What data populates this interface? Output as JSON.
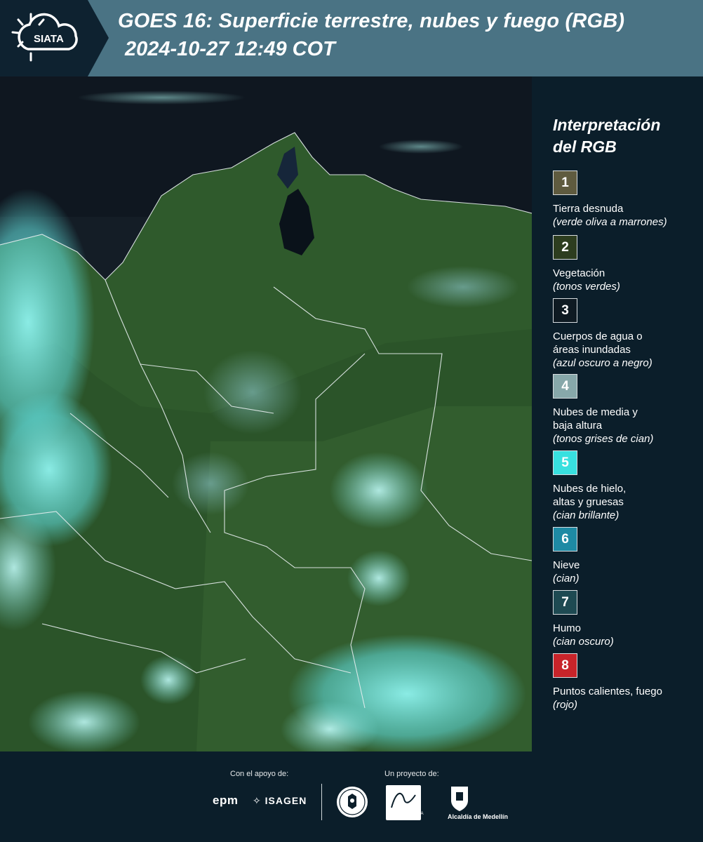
{
  "header": {
    "logo_text": "SIATA",
    "title_line1": "GOES 16: Superficie terrestre, nubes y fuego (RGB)",
    "title_line2": "2024-10-27 12:49 COT"
  },
  "colors": {
    "header_bg": "#4a7384",
    "panel_bg": "#0b1e2a",
    "logo_bg": "#0e2230"
  },
  "legend": {
    "title_line1": "Interpretación",
    "title_line2": "del RGB",
    "items": [
      {
        "number": "1",
        "color": "#5f5b3f",
        "label": "Tierra desnuda",
        "note": "(verde oliva a marrones)"
      },
      {
        "number": "2",
        "color": "#2d3d1f",
        "label": "Vegetación",
        "note": "(tonos verdes)"
      },
      {
        "number": "3",
        "color": "#0e1a22",
        "label": "Cuerpos de agua o áreas inundadas",
        "note": "(azul oscuro a negro)"
      },
      {
        "number": "4",
        "color": "#87a8aa",
        "label": "Nubes de media y baja altura",
        "note": "(tonos grises de cian)"
      },
      {
        "number": "5",
        "color": "#38e0df",
        "label": "Nubes de hielo, altas y gruesas",
        "note": "(cian brillante)"
      },
      {
        "number": "6",
        "color": "#1e8aa4",
        "label": "Nieve",
        "note": "(cian)"
      },
      {
        "number": "7",
        "color": "#1e4a52",
        "label": "Humo",
        "note": "(cian oscuro)"
      },
      {
        "number": "8",
        "color": "#c8242a",
        "label": "Puntos calientes, fuego",
        "note": "(rojo)"
      }
    ]
  },
  "footer": {
    "support_label": "Con el apoyo de:",
    "project_label": "Un proyecto de:",
    "sponsor_1": "epm",
    "sponsor_2": "ISAGEN",
    "partner_area": "METROPOLITANA Valle de Aburrá",
    "partner_alcaldia": "Alcaldía de Medellín"
  }
}
